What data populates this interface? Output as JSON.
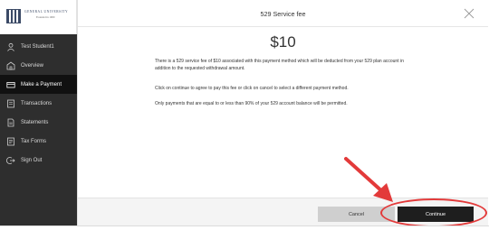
{
  "brand": {
    "name": "GENERAL UNIVERSITY",
    "sub": "Founded in 1900"
  },
  "sidebar": {
    "items": [
      {
        "label": "Test Student1",
        "icon": "user-icon"
      },
      {
        "label": "Overview",
        "icon": "overview-icon"
      },
      {
        "label": "Make a Payment",
        "icon": "payment-icon",
        "active": true
      },
      {
        "label": "Transactions",
        "icon": "transactions-icon"
      },
      {
        "label": "Statements",
        "icon": "statements-icon"
      },
      {
        "label": "Tax Forms",
        "icon": "tax-forms-icon"
      },
      {
        "label": "Sign Out",
        "icon": "sign-out-icon"
      }
    ]
  },
  "modal": {
    "title": "529 Service fee",
    "amount": "$10",
    "paragraphs": [
      "There is a 529 service fee of $10 associated with this payment method which will be deducted from your 529 plan account in addition to the requested withdrawal amount.",
      "Click on continue to agree to pay this fee or click on cancel to select a different payment method.",
      "Only payments that are equal to or less than 90% of your 529 account balance will be permitted."
    ],
    "cancel_label": "Cancel",
    "continue_label": "Continue"
  },
  "colors": {
    "sidebar_bg": "#2e2e2e",
    "active_bg": "#111111",
    "annotation": "#e33a3a",
    "primary_button": "#1e1e1e"
  }
}
